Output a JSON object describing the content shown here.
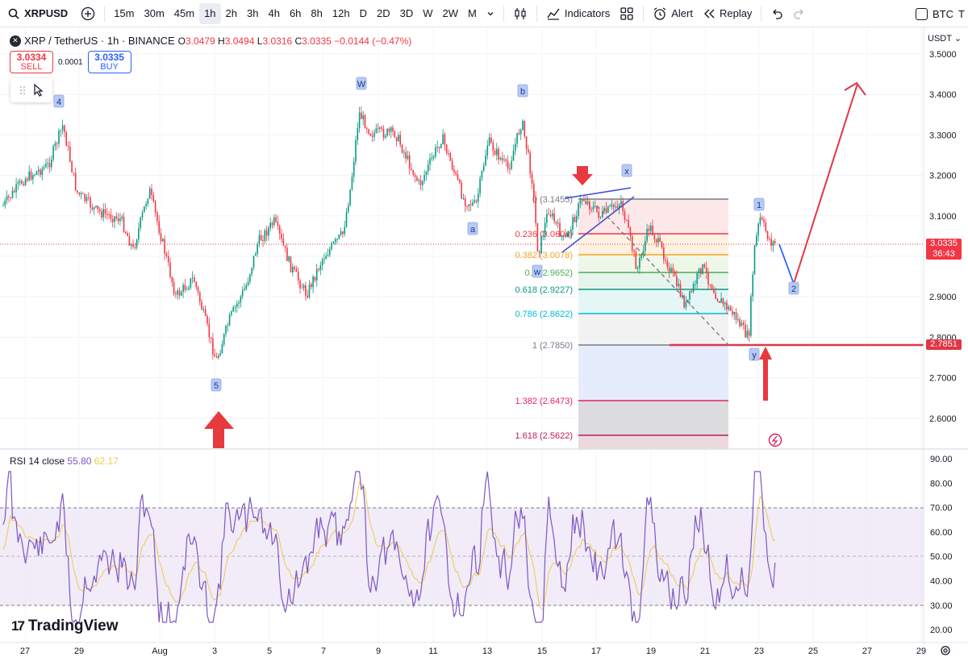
{
  "toolbar": {
    "symbol": "XRPUSD",
    "timeframes": [
      "15m",
      "30m",
      "45m",
      "1h",
      "2h",
      "3h",
      "4h",
      "6h",
      "8h",
      "12h",
      "D",
      "2D",
      "3D",
      "W",
      "2W",
      "M"
    ],
    "active_timeframe": "1h",
    "indicators_label": "Indicators",
    "alert_label": "Alert",
    "replay_label": "Replay",
    "compare_label": "BTC",
    "compare_suffix": "T"
  },
  "legend": {
    "title": "XRP / TetherUS · 1h · BINANCE",
    "o_label": "O",
    "o_value": "3.0479",
    "h_label": "H",
    "h_value": "3.0494",
    "l_label": "L",
    "l_value": "3.0316",
    "c_label": "C",
    "c_value": "3.0335",
    "change": "−0.0144 (−0.47%)"
  },
  "trade": {
    "sell_price": "3.0334",
    "sell_label": "SELL",
    "spread": "0.0001",
    "buy_price": "3.0335",
    "buy_label": "BUY"
  },
  "price_axis": {
    "currency": "USDT",
    "ticks": [
      "3.5000",
      "3.4000",
      "3.3000",
      "3.2000",
      "3.1000",
      "3.0000",
      "2.9000",
      "2.8000",
      "2.7000",
      "2.6000"
    ],
    "last_price": "3.0335",
    "countdown": "36:43",
    "level_tag": "2.7851"
  },
  "rsi": {
    "label": "RSI 14 close",
    "value": "55.80",
    "ma_value": "62.17",
    "ticks": [
      "90.00",
      "80.00",
      "70.00",
      "60.00",
      "50.00",
      "40.00",
      "30.00",
      "20.00"
    ]
  },
  "time_axis": {
    "labels": [
      "27",
      "29",
      "Aug",
      "3",
      "5",
      "7",
      "9",
      "11",
      "13",
      "15",
      "17",
      "19",
      "21",
      "23",
      "25",
      "27",
      "29"
    ]
  },
  "fib": {
    "levels": [
      {
        "label": "0 (3.1455)",
        "color": "#787b86"
      },
      {
        "label": "0.236 (3.0604)",
        "color": "#f23645"
      },
      {
        "label": "0.382 (3.0078)",
        "color": "#f5a623"
      },
      {
        "label": "0.5 (2.9652)",
        "color": "#4caf50"
      },
      {
        "label": "0.618 (2.9227)",
        "color": "#089981"
      },
      {
        "label": "0.786 (2.8622)",
        "color": "#00bcd4"
      },
      {
        "label": "1 (2.7850)",
        "color": "#787b86"
      },
      {
        "label": "1.382 (2.6473)",
        "color": "#e91e63"
      },
      {
        "label": "1.618 (2.5622)",
        "color": "#c2185b"
      }
    ]
  },
  "wave_labels": [
    "4",
    "5",
    "W",
    "a",
    "b",
    "x",
    "w",
    "1",
    "2",
    "y"
  ],
  "branding": {
    "name": "TradingView"
  },
  "colors": {
    "accent": "#2962ff",
    "down": "#f23645",
    "up": "#089981",
    "rsi": "#7e57c2",
    "rsi_ma": "#f0c94c"
  }
}
